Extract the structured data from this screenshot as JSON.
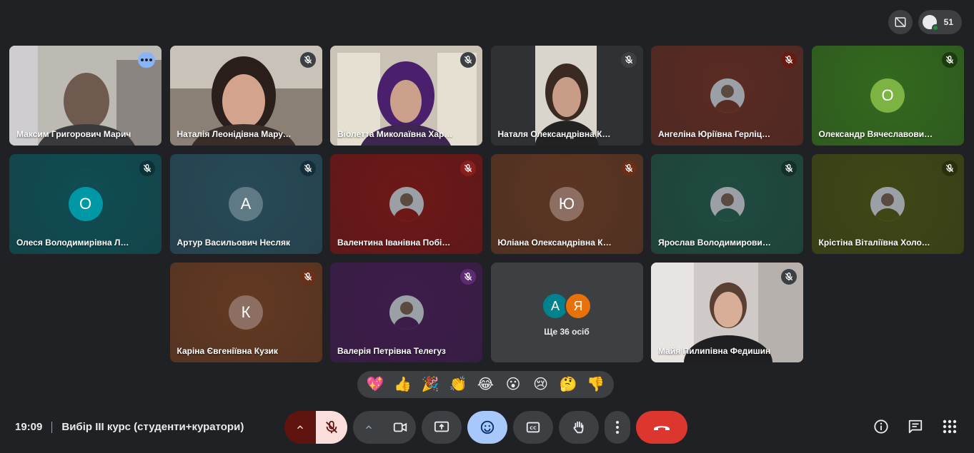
{
  "top_bar": {
    "participants_count": "51"
  },
  "tiles": [
    {
      "name": "Максим Григорович Марич",
      "type": "video",
      "bg": "#bdbab3",
      "active": true,
      "mic_bg": ""
    },
    {
      "name": "Наталія Леонідівна Марусяк",
      "type": "video",
      "bg": "#8a8076",
      "active": false,
      "mic_bg": "#3c4043"
    },
    {
      "name": "Віолетта Миколаївна Хараба…",
      "type": "video",
      "bg": "#c9c2b5",
      "active": false,
      "mic_bg": "#3c4043"
    },
    {
      "name": "Наталя Олександрівна Ковал…",
      "type": "video",
      "bg": "#3c4043",
      "active": false,
      "mic_bg": "#3c4043"
    },
    {
      "name": "Ангеліна Юріївна Герліцька",
      "type": "photo",
      "bg": "#5a2b23",
      "active": false,
      "mic_bg": "#6b1a12"
    },
    {
      "name": "Олександр Вячеславович Му…",
      "type": "letter",
      "letter": "О",
      "letter_bg": "#7cb342",
      "bg": "#33691e",
      "active": false,
      "mic_bg": "#1b3d0d"
    },
    {
      "name": "Олеся Володимирівна Лутчак",
      "type": "letter",
      "letter": "О",
      "letter_bg": "#0097a7",
      "bg": "#0f4d53",
      "active": false,
      "mic_bg": "#0b3236"
    },
    {
      "name": "Артур Васильович Несляк",
      "type": "letter",
      "letter": "А",
      "letter_bg": "#5f7985",
      "bg": "#274a58",
      "active": false,
      "mic_bg": "#152f3a"
    },
    {
      "name": "Валентина Іванівна Побіжан",
      "type": "photo",
      "bg": "#6e1717",
      "active": false,
      "mic_bg": "#8b1d1d"
    },
    {
      "name": "Юліана Олександрівна Карпі…",
      "type": "letter",
      "letter": "Ю",
      "letter_bg": "#8d6e63",
      "bg": "#5c3522",
      "active": false,
      "mic_bg": "#6b2e17"
    },
    {
      "name": "Ярослав Володимирович Мо…",
      "type": "photo",
      "bg": "#1f4b40",
      "active": false,
      "mic_bg": "#123229"
    },
    {
      "name": "Крістіна Віталіївна Холодило",
      "type": "photo",
      "bg": "#3f4716",
      "active": false,
      "mic_bg": "#2a300c"
    },
    {
      "name": "Каріна Євгеніївна Кузик",
      "type": "letter",
      "letter": "К",
      "letter_bg": "#8d6e63",
      "bg": "#633922",
      "active": false,
      "mic_bg": "#6b2e17"
    },
    {
      "name": "Валерія Петрівна Телегуз",
      "type": "photo",
      "bg": "#3d1c4a",
      "active": false,
      "mic_bg": "#5e2a75"
    },
    {
      "name": "",
      "type": "more",
      "bg": "#3c4043",
      "active": false,
      "mic_bg": ""
    },
    {
      "name": "Майя Пилипівна Федишин",
      "type": "video",
      "bg": "#cfcac8",
      "active": false,
      "mic_bg": "#3c4043"
    }
  ],
  "more_tile": {
    "avatars": [
      {
        "letter": "А",
        "bg": "#00838f"
      },
      {
        "letter": "Я",
        "bg": "#e8710a"
      }
    ],
    "label": "Ще 36 осіб"
  },
  "reactions": [
    "💖",
    "👍",
    "🎉",
    "👏",
    "😂",
    "😮",
    "😢",
    "🤔",
    "👎"
  ],
  "meeting": {
    "time": "19:09",
    "title": "Вибір III курс (студенти+куратори)"
  },
  "colors": {
    "bg": "#202124",
    "control": "#3c4043",
    "mic_off": "#f9dedc",
    "mic_arrow": "#601410",
    "reaction_active": "#a8c7fa",
    "end_call": "#dc362e"
  }
}
